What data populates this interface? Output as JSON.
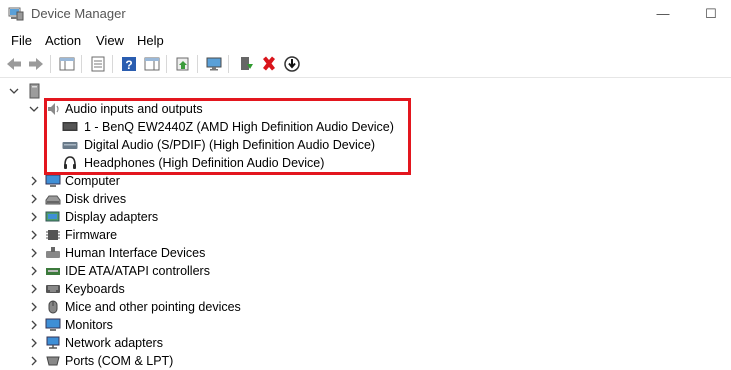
{
  "window": {
    "title": "Device Manager",
    "minimize": "—",
    "maximize": "☐"
  },
  "menu": [
    "File",
    "Action",
    "View",
    "Help"
  ],
  "tree": {
    "root_label": "",
    "expanded_category": {
      "label": "Audio inputs and outputs",
      "children": [
        "1 - BenQ EW2440Z (AMD High Definition Audio Device)",
        "Digital Audio (S/PDIF) (High Definition Audio Device)",
        "Headphones (High Definition Audio Device)"
      ]
    },
    "categories": [
      "Computer",
      "Disk drives",
      "Display adapters",
      "Firmware",
      "Human Interface Devices",
      "IDE ATA/ATAPI controllers",
      "Keyboards",
      "Mice and other pointing devices",
      "Monitors",
      "Network adapters",
      "Ports (COM & LPT)"
    ]
  },
  "colors": {
    "highlight_border": "#e3161e",
    "uninstall_x": "#d9141b"
  }
}
